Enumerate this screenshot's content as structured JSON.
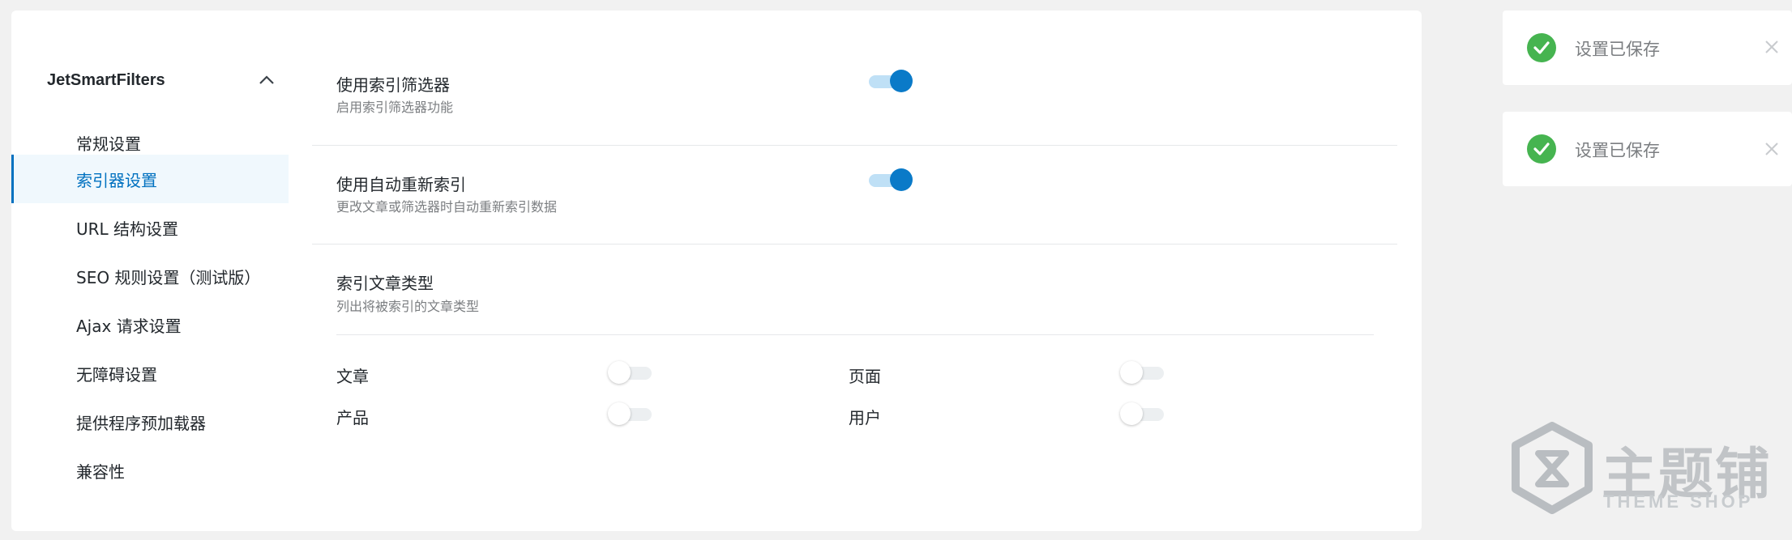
{
  "sidebar": {
    "title": "JetSmartFilters",
    "items": [
      {
        "label": "常规设置"
      },
      {
        "label": "索引器设置",
        "active": true
      },
      {
        "label": "URL 结构设置"
      },
      {
        "label": "SEO 规则设置（测试版）"
      },
      {
        "label": "Ajax 请求设置"
      },
      {
        "label": "无障碍设置"
      },
      {
        "label": "提供程序预加载器"
      },
      {
        "label": "兼容性"
      }
    ]
  },
  "settings": {
    "use_indexer": {
      "title": "使用索引筛选器",
      "desc": "启用索引筛选器功能",
      "enabled": true
    },
    "auto_reindex": {
      "title": "使用自动重新索引",
      "desc": "更改文章或筛选器时自动重新索引数据",
      "enabled": true
    },
    "post_types": {
      "title": "索引文章类型",
      "desc": "列出将被索引的文章类型",
      "items": [
        {
          "label": "文章",
          "enabled": false
        },
        {
          "label": "页面",
          "enabled": false
        },
        {
          "label": "产品",
          "enabled": false
        },
        {
          "label": "用户",
          "enabled": false
        }
      ]
    }
  },
  "notices": [
    {
      "message": "设置已保存"
    },
    {
      "message": "设置已保存"
    }
  ],
  "watermark": {
    "cn": "主题铺",
    "en": "THEME SHOP"
  },
  "colors": {
    "accent": "#0071c0",
    "toggle_on": "#0a7ac8",
    "success": "#46b450"
  },
  "icons": {
    "chevron": "chevron-up-icon",
    "check": "check-circle-icon",
    "close": "close-icon"
  }
}
